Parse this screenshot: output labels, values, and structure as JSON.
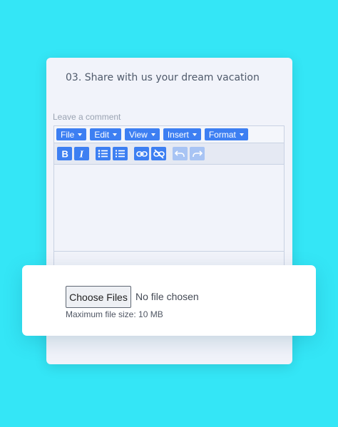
{
  "question": {
    "title": "03. Share with us your dream vacation"
  },
  "comment": {
    "label": "Leave a comment"
  },
  "editor": {
    "menus": [
      {
        "label": "File"
      },
      {
        "label": "Edit"
      },
      {
        "label": "View"
      },
      {
        "label": "Insert"
      },
      {
        "label": "Format"
      }
    ],
    "tools": [
      {
        "name": "bold-icon",
        "glyph": "B",
        "enabled": true
      },
      {
        "name": "italic-icon",
        "glyph": "I",
        "enabled": true
      },
      {
        "name": "bullet-list-icon",
        "enabled": true
      },
      {
        "name": "numbered-list-icon",
        "enabled": true
      },
      {
        "name": "link-icon",
        "enabled": true
      },
      {
        "name": "unlink-icon",
        "enabled": true
      },
      {
        "name": "undo-icon",
        "enabled": false
      },
      {
        "name": "redo-icon",
        "enabled": false
      }
    ],
    "accent": "#3d7ff2"
  },
  "upload": {
    "button_label": "Choose Files",
    "status": "No file chosen",
    "max_size": "Maximum file size: 10 MB"
  },
  "colors": {
    "background": "#34e6f6",
    "card": "#f1f3fa"
  }
}
